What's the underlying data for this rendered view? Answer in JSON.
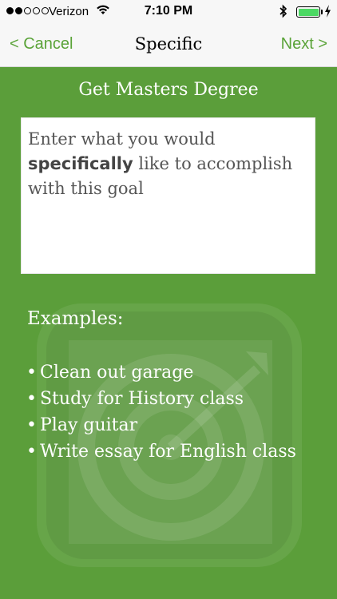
{
  "status_bar": {
    "carrier": "Verizon",
    "time": "7:10 PM",
    "signal_bars_filled": 2,
    "signal_bars_total": 5,
    "battery_level": 1.0,
    "battery_color": "#4cd964"
  },
  "nav": {
    "cancel_label": "< Cancel",
    "title": "Specific",
    "next_label": "Next >",
    "accent_color": "#5aa338"
  },
  "goal": {
    "title": "Get Masters Degree"
  },
  "input": {
    "placeholder_before": "Enter what you would ",
    "placeholder_bold": "specifically",
    "placeholder_after": " like to accomplish with this goal"
  },
  "examples": {
    "heading": "Examples:",
    "bullet": "•",
    "items": [
      "Clean out garage",
      "Study for History class",
      "Play guitar",
      "Write essay for English class"
    ]
  },
  "theme": {
    "background": "#5b9e3a"
  }
}
